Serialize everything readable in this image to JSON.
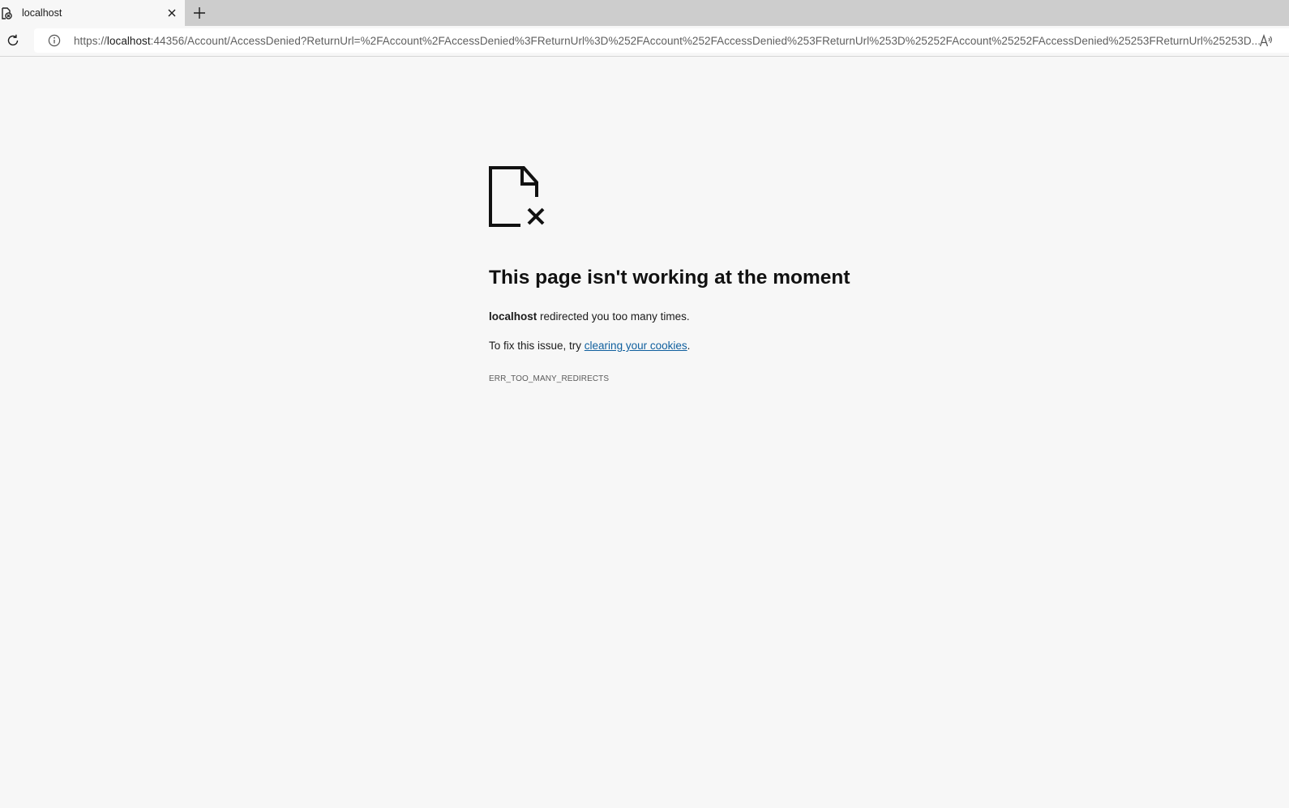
{
  "tab": {
    "title": "localhost",
    "favicon": "error-document-icon"
  },
  "toolbar": {
    "url_scheme": "https://",
    "url_host": "localhost",
    "url_rest": ":44356/Account/AccessDenied?ReturnUrl=%2FAccount%2FAccessDenied%3FReturnUrl%3D%252FAccount%252FAccessDenied%253FReturnUrl%253D%25252FAccount%25252FAccessDenied%25253FReturnUrl%25253D..."
  },
  "error": {
    "title": "This page isn't working at the moment",
    "host": "localhost",
    "desc_suffix": " redirected you too many times.",
    "fix_prefix": "To fix this issue, try ",
    "fix_link": "clearing your cookies",
    "fix_suffix": ".",
    "code": "ERR_TOO_MANY_REDIRECTS"
  },
  "colors": {
    "page_bg": "#f7f7f7",
    "tabstrip_bg": "#cdcdcd",
    "link": "#0f5f9e"
  }
}
